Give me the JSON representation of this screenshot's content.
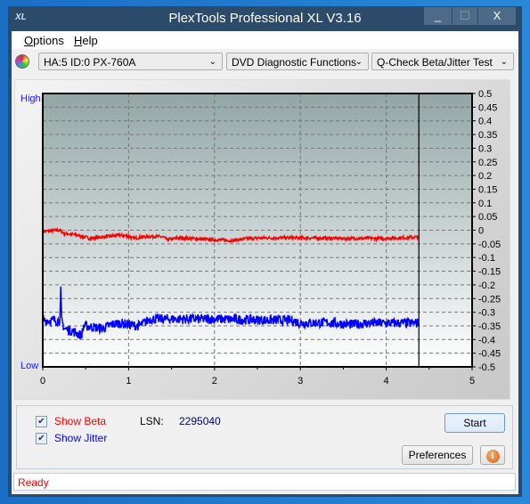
{
  "window": {
    "title": "PlexTools Professional XL V3.16",
    "logo": "XL",
    "minimize": "_",
    "maximize": "☐",
    "close": "X"
  },
  "menu": [
    {
      "label": "Options",
      "mn": "O",
      "rest": "ptions"
    },
    {
      "label": "Help",
      "mn": "H",
      "rest": "elp"
    }
  ],
  "toolbar": {
    "drive": "HA:5 ID:0  PX-760A",
    "function": "DVD Diagnostic Functions",
    "test": "Q-Check Beta/Jitter Test"
  },
  "chart_data": {
    "type": "line",
    "xlim": [
      0,
      5
    ],
    "ylim": [
      -0.5,
      0.5
    ],
    "x_ticks": [
      "0",
      "1",
      "2",
      "3",
      "4",
      "5"
    ],
    "y_ticks": [
      "0.5",
      "0.45",
      "0.4",
      "0.35",
      "0.3",
      "0.25",
      "0.2",
      "0.15",
      "0.1",
      "0.05",
      "0",
      "-0.05",
      "-0.1",
      "-0.15",
      "-0.2",
      "-0.25",
      "-0.3",
      "-0.35",
      "-0.4",
      "-0.45",
      "-0.5"
    ],
    "left_labels": {
      "high": "High",
      "low": "Low"
    },
    "grid": true,
    "end_marker_x": 4.38,
    "series": [
      {
        "color": "#ff0000",
        "points": [
          [
            0,
            -0.005
          ],
          [
            0.1,
            -0.002
          ],
          [
            0.2,
            0.0
          ],
          [
            0.25,
            -0.012
          ],
          [
            0.35,
            -0.015
          ],
          [
            0.45,
            -0.022
          ],
          [
            0.55,
            -0.03
          ],
          [
            0.7,
            -0.025
          ],
          [
            0.9,
            -0.018
          ],
          [
            1.0,
            -0.022
          ],
          [
            1.05,
            -0.03
          ],
          [
            1.15,
            -0.025
          ],
          [
            1.3,
            -0.022
          ],
          [
            1.4,
            -0.025
          ],
          [
            1.45,
            -0.035
          ],
          [
            1.6,
            -0.028
          ],
          [
            1.8,
            -0.032
          ],
          [
            2.0,
            -0.035
          ],
          [
            2.2,
            -0.038
          ],
          [
            2.4,
            -0.03
          ],
          [
            2.6,
            -0.028
          ],
          [
            3.0,
            -0.028
          ],
          [
            3.5,
            -0.03
          ],
          [
            4.0,
            -0.03
          ],
          [
            4.38,
            -0.025
          ]
        ]
      },
      {
        "color": "#0000ff",
        "points": [
          [
            0,
            -0.33
          ],
          [
            0.2,
            -0.33
          ],
          [
            0.21,
            -0.22
          ],
          [
            0.22,
            -0.33
          ],
          [
            0.25,
            -0.36
          ],
          [
            0.35,
            -0.37
          ],
          [
            0.45,
            -0.385
          ],
          [
            0.48,
            -0.35
          ],
          [
            0.6,
            -0.355
          ],
          [
            0.7,
            -0.36
          ],
          [
            0.8,
            -0.345
          ],
          [
            0.9,
            -0.34
          ],
          [
            1.1,
            -0.35
          ],
          [
            1.15,
            -0.345
          ],
          [
            1.25,
            -0.325
          ],
          [
            1.5,
            -0.325
          ],
          [
            2.0,
            -0.325
          ],
          [
            2.5,
            -0.328
          ],
          [
            2.9,
            -0.33
          ],
          [
            3.0,
            -0.34
          ],
          [
            3.3,
            -0.338
          ],
          [
            3.6,
            -0.345
          ],
          [
            3.8,
            -0.34
          ],
          [
            4.1,
            -0.34
          ],
          [
            4.38,
            -0.34
          ]
        ]
      }
    ]
  },
  "controls": {
    "show_beta": "Show Beta",
    "show_beta_checked": true,
    "show_jitter": "Show Jitter",
    "show_jitter_checked": true,
    "lsn_label": "LSN:",
    "lsn_value": "2295040",
    "start": "Start",
    "preferences": "Preferences",
    "info_icon": "info-icon"
  },
  "colors": {
    "beta": "#ff0000",
    "jitter": "#0000ff",
    "titlebar": "#2c4a6a"
  },
  "status": "Ready"
}
